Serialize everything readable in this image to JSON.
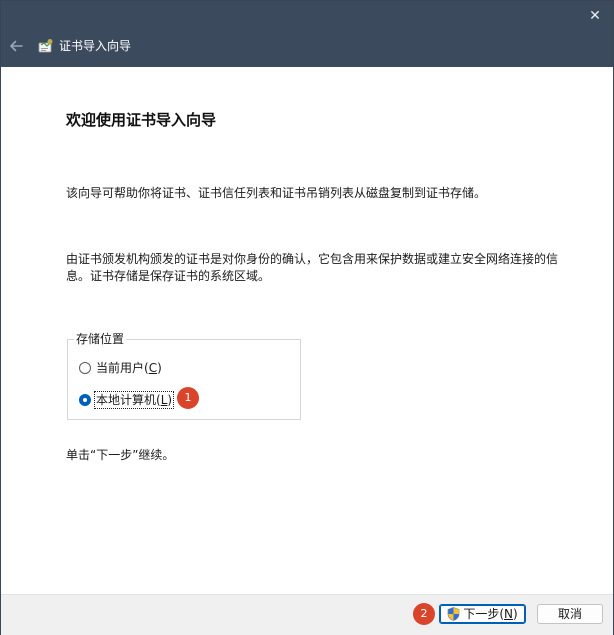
{
  "window": {
    "title": "证书导入向导",
    "close_glyph": "✕"
  },
  "icons": {
    "back": "back-arrow-icon",
    "app": "certificate-icon",
    "shield": "uac-shield-icon"
  },
  "content": {
    "heading": "欢迎使用证书导入向导",
    "para1": "该向导可帮助你将证书、证书信任列表和证书吊销列表从磁盘复制到证书存储。",
    "para2": "由证书颁发机构颁发的证书是对你身份的确认，它包含用来保护数据或建立安全网络连接的信息。证书存储是保存证书的系统区域。",
    "para3": "单击“下一步”继续。"
  },
  "store_location": {
    "legend": "存储位置",
    "options": [
      {
        "label": "当前用户(",
        "mnemonic": "C",
        "suffix": ")",
        "selected": false
      },
      {
        "label": "本地计算机(",
        "mnemonic": "L",
        "suffix": ")",
        "selected": true
      }
    ]
  },
  "badges": [
    "1",
    "2"
  ],
  "footer": {
    "next_label": "下一步(",
    "next_mnemonic": "N",
    "next_suffix": ")",
    "cancel_label": "取消"
  },
  "colors": {
    "titlebar": "#3c4a5e",
    "accent": "#005fb8",
    "badge": "#d9452b"
  }
}
